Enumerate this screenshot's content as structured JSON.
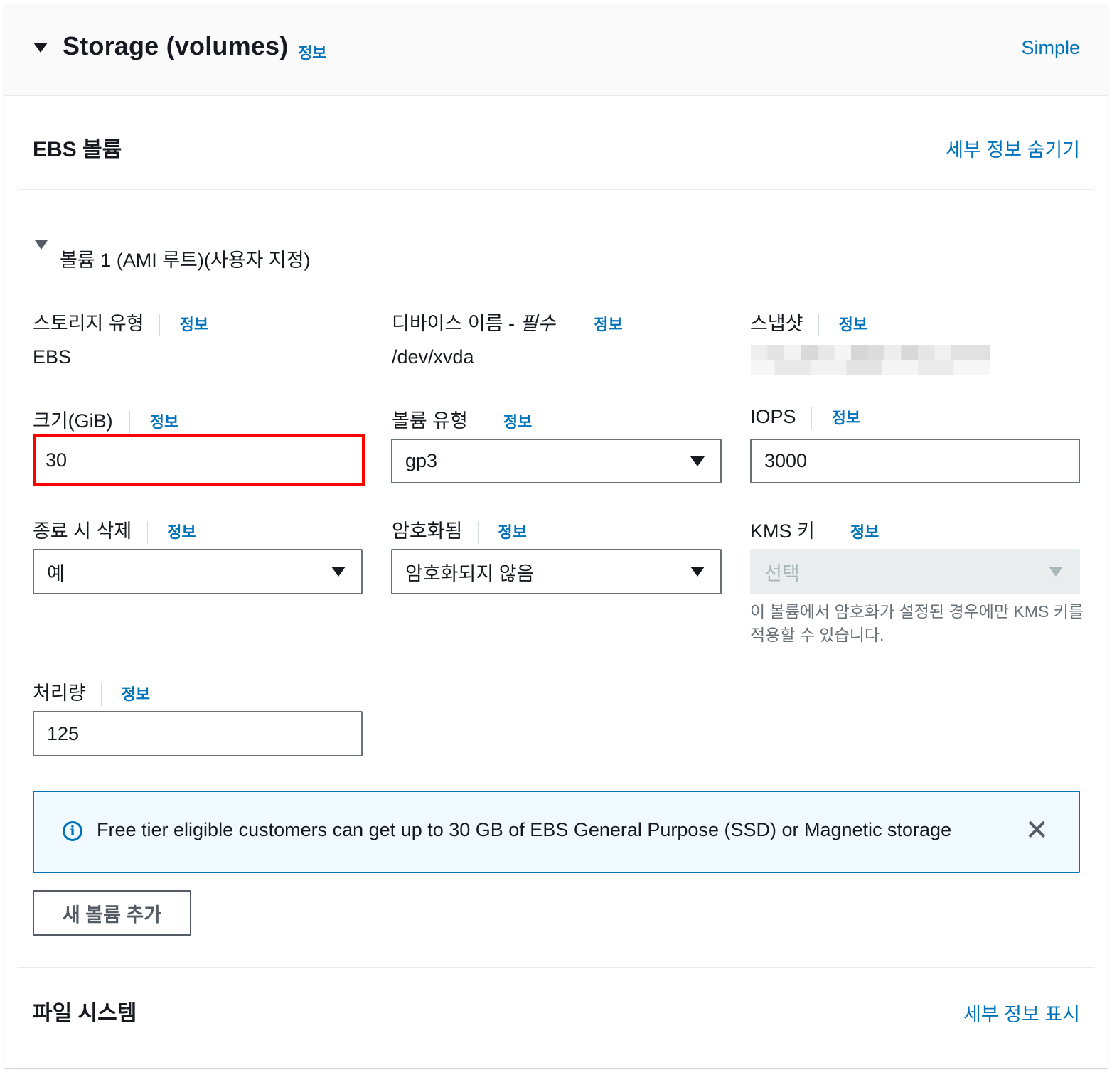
{
  "header": {
    "title": "Storage (volumes)",
    "info": "정보",
    "mode_link": "Simple"
  },
  "ebs": {
    "title": "EBS 볼륨",
    "toggle_link": "세부 정보 숨기기"
  },
  "volume": {
    "title": "볼륨 1 (AMI 루트)(사용자 지정)",
    "storage_type": {
      "label": "스토리지 유형",
      "info": "정보",
      "value": "EBS"
    },
    "device_name": {
      "label": "디바이스 이름 - ",
      "label_required": "필수",
      "info": "정보",
      "value": "/dev/xvda"
    },
    "snapshot": {
      "label": "스냅샷",
      "info": "정보"
    },
    "size": {
      "label": "크기(GiB)",
      "info": "정보",
      "value": "30"
    },
    "volume_type": {
      "label": "볼륨 유형",
      "info": "정보",
      "value": "gp3"
    },
    "iops": {
      "label": "IOPS",
      "info": "정보",
      "value": "3000"
    },
    "delete_on_termination": {
      "label": "종료 시 삭제",
      "info": "정보",
      "value": "예"
    },
    "encrypted": {
      "label": "암호화됨",
      "info": "정보",
      "value": "암호화되지 않음"
    },
    "kms_key": {
      "label": "KMS 키",
      "info": "정보",
      "placeholder": "선택",
      "hint_line1": "이 볼륨에서 암호화가 설정된 경우에만 KMS 키를",
      "hint_line2": "적용할 수 있습니다."
    },
    "throughput": {
      "label": "처리량",
      "info": "정보",
      "value": "125"
    }
  },
  "alert": {
    "icon": "info-icon",
    "text": "Free tier eligible customers can get up to 30 GB of EBS General Purpose (SSD) or Magnetic storage",
    "close": "✕"
  },
  "add_volume_button": "새 볼륨 추가",
  "filesystem": {
    "title": "파일 시스템",
    "toggle_link": "세부 정보 표시"
  },
  "colors": {
    "link": "#0073bb",
    "highlight": "#ff0000",
    "alert_bg": "#f1faff"
  }
}
